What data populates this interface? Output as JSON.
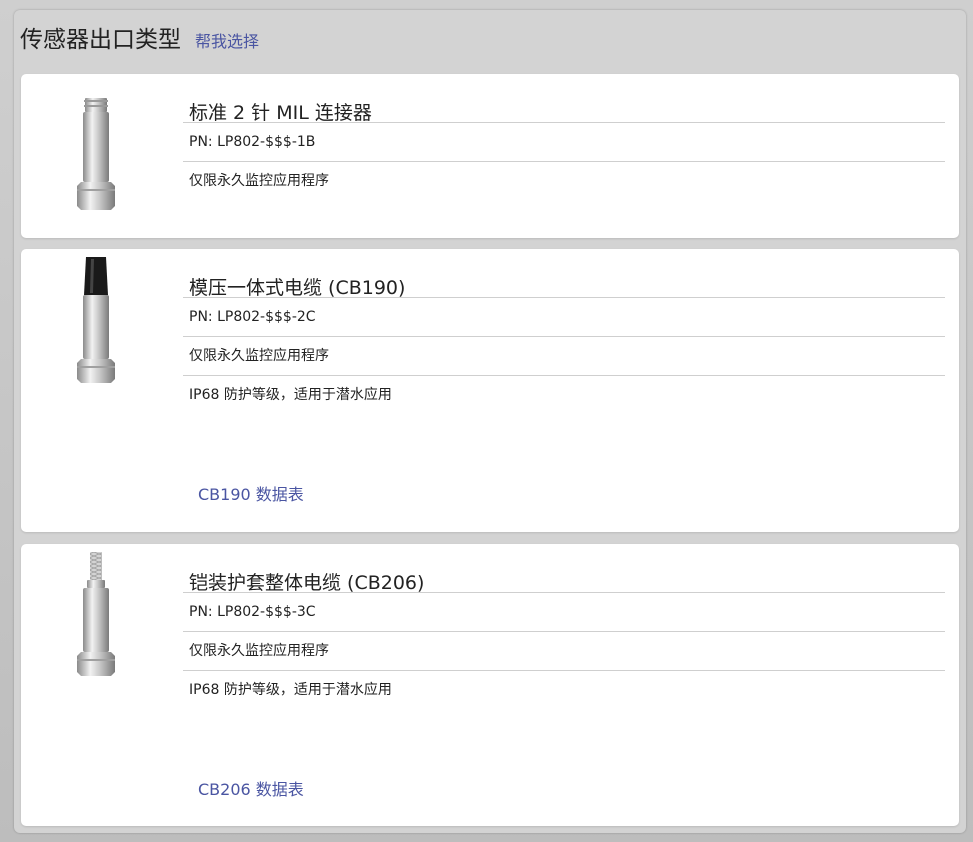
{
  "header": {
    "title": "传感器出口类型",
    "help_link": "帮我选择"
  },
  "options": [
    {
      "title": "标准 2 针 MIL 连接器",
      "pn": "PN: LP802-$$$-1B",
      "rows": [
        "仅限永久监控应用程序"
      ],
      "image_icon": "mil-connector-sensor-icon"
    },
    {
      "title": "模压一体式电缆 (CB190)",
      "pn": "PN: LP802-$$$-2C",
      "rows": [
        "仅限永久监控应用程序",
        "IP68 防护等级，适用于潜水应用"
      ],
      "datasheet": "CB190 数据表",
      "image_icon": "molded-cable-sensor-icon"
    },
    {
      "title": "铠装护套整体电缆 (CB206)",
      "pn": "PN: LP802-$$$-3C",
      "rows": [
        "仅限永久监控应用程序",
        "IP68 防护等级，适用于潜水应用"
      ],
      "datasheet": "CB206 数据表",
      "image_icon": "armored-cable-sensor-icon"
    }
  ],
  "colors": {
    "link": "#4a55a2",
    "panel_bg": "#d3d3d3",
    "card_bg": "#ffffff",
    "divider": "#cfcfcf"
  }
}
